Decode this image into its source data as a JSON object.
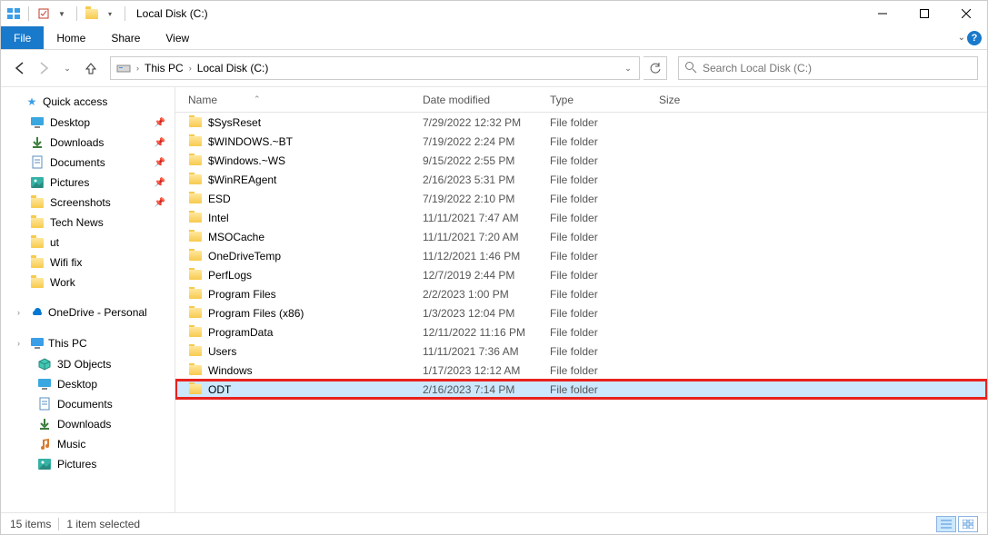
{
  "title": "Local Disk (C:)",
  "menubar": {
    "file": "File",
    "home": "Home",
    "share": "Share",
    "view": "View"
  },
  "breadcrumbs": [
    {
      "label": "This PC"
    },
    {
      "label": "Local Disk (C:)"
    }
  ],
  "search_placeholder": "Search Local Disk (C:)",
  "sidebar": {
    "quick_access": "Quick access",
    "qa_items": [
      {
        "label": "Desktop",
        "pinned": true,
        "icon": "desktop"
      },
      {
        "label": "Downloads",
        "pinned": true,
        "icon": "downloads"
      },
      {
        "label": "Documents",
        "pinned": true,
        "icon": "documents"
      },
      {
        "label": "Pictures",
        "pinned": true,
        "icon": "pictures"
      },
      {
        "label": "Screenshots",
        "pinned": true,
        "icon": "folder"
      },
      {
        "label": "Tech News",
        "pinned": false,
        "icon": "folder"
      },
      {
        "label": "ut",
        "pinned": false,
        "icon": "folder"
      },
      {
        "label": "Wifi fix",
        "pinned": false,
        "icon": "folder"
      },
      {
        "label": "Work",
        "pinned": false,
        "icon": "folder"
      }
    ],
    "onedrive": "OneDrive - Personal",
    "this_pc": "This PC",
    "pc_items": [
      {
        "label": "3D Objects",
        "icon": "3d"
      },
      {
        "label": "Desktop",
        "icon": "desktop"
      },
      {
        "label": "Documents",
        "icon": "documents"
      },
      {
        "label": "Downloads",
        "icon": "downloads"
      },
      {
        "label": "Music",
        "icon": "music"
      },
      {
        "label": "Pictures",
        "icon": "pictures"
      }
    ]
  },
  "columns": {
    "name": "Name",
    "date": "Date modified",
    "type": "Type",
    "size": "Size"
  },
  "files": [
    {
      "name": "$SysReset",
      "date": "7/29/2022 12:32 PM",
      "type": "File folder"
    },
    {
      "name": "$WINDOWS.~BT",
      "date": "7/19/2022 2:24 PM",
      "type": "File folder"
    },
    {
      "name": "$Windows.~WS",
      "date": "9/15/2022 2:55 PM",
      "type": "File folder"
    },
    {
      "name": "$WinREAgent",
      "date": "2/16/2023 5:31 PM",
      "type": "File folder"
    },
    {
      "name": "ESD",
      "date": "7/19/2022 2:10 PM",
      "type": "File folder"
    },
    {
      "name": "Intel",
      "date": "11/11/2021 7:47 AM",
      "type": "File folder"
    },
    {
      "name": "MSOCache",
      "date": "11/11/2021 7:20 AM",
      "type": "File folder"
    },
    {
      "name": "OneDriveTemp",
      "date": "11/12/2021 1:46 PM",
      "type": "File folder"
    },
    {
      "name": "PerfLogs",
      "date": "12/7/2019 2:44 PM",
      "type": "File folder"
    },
    {
      "name": "Program Files",
      "date": "2/2/2023 1:00 PM",
      "type": "File folder"
    },
    {
      "name": "Program Files (x86)",
      "date": "1/3/2023 12:04 PM",
      "type": "File folder"
    },
    {
      "name": "ProgramData",
      "date": "12/11/2022 11:16 PM",
      "type": "File folder"
    },
    {
      "name": "Users",
      "date": "11/11/2021 7:36 AM",
      "type": "File folder"
    },
    {
      "name": "Windows",
      "date": "1/17/2023 12:12 AM",
      "type": "File folder"
    },
    {
      "name": "ODT",
      "date": "2/16/2023 7:14 PM",
      "type": "File folder",
      "selected": true,
      "highlighted": true
    }
  ],
  "status": {
    "count": "15 items",
    "selected": "1 item selected"
  }
}
